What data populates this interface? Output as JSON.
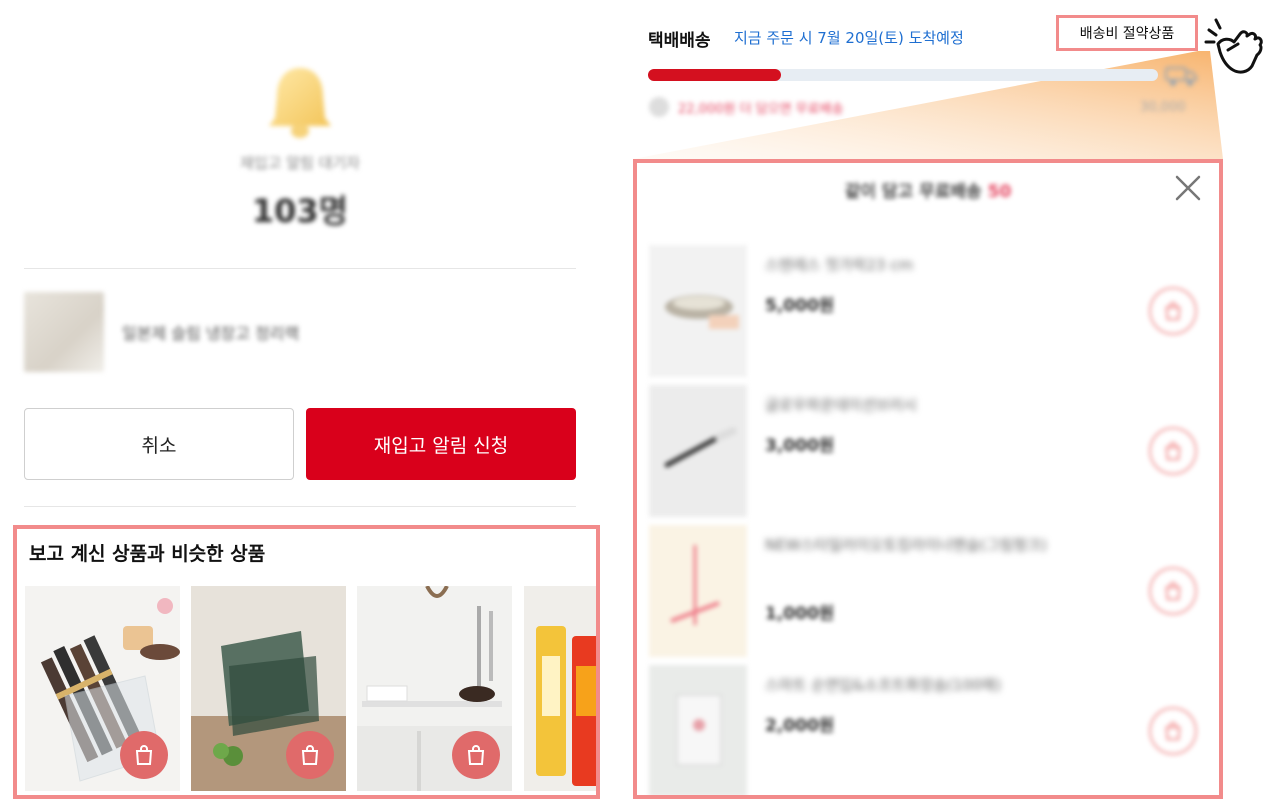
{
  "restock": {
    "waiting_label": "재입고 알림 대기자",
    "waiting_count": "103명",
    "product_name": "일본제 슬림 냉장고 정리랙",
    "cancel_label": "취소",
    "apply_label": "재입고 알림 신청"
  },
  "similar": {
    "title": "보고 계신 상품과 비슷한 상품",
    "items": [
      {
        "icon": "shopping-bag-icon"
      },
      {
        "icon": "shopping-bag-icon"
      },
      {
        "icon": "shopping-bag-icon"
      },
      {
        "icon": "shopping-bag-icon"
      }
    ]
  },
  "delivery": {
    "label": "택배배송",
    "date_text": "지금 주문 시 7월 20일(토) 도착예정",
    "saver_tag": "배송비 절약상품",
    "progress": 0.26,
    "progress_note": "22,000원 더 담으면 무료배송",
    "progress_end": "30,000"
  },
  "popup": {
    "title": "같이 담고 무료배송",
    "title_count": "50",
    "items": [
      {
        "name": "스텐레스 젓가락23 cm",
        "price": "5,000원"
      },
      {
        "name": "글로우파운데이션브러시",
        "price": "3,000원"
      },
      {
        "name": "NEW스타일러이오토킹라이너펜슬(그림펑크)",
        "price": "1,000원"
      },
      {
        "name": "스마트 순면입&소프트화장솜(100매)",
        "price": "2,000원"
      }
    ]
  },
  "colors": {
    "brand_red": "#d9001b",
    "highlight_border": "#f28b8b",
    "link_blue": "#1f6fd1"
  }
}
